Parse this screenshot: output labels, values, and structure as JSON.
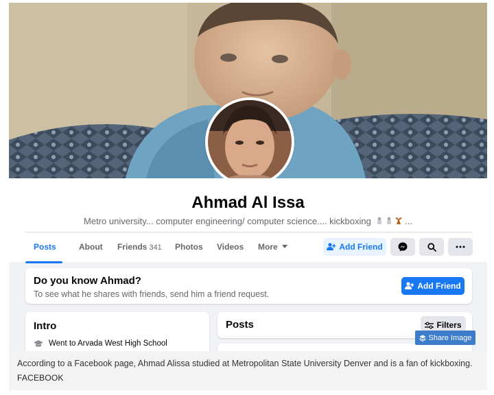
{
  "profile": {
    "name": "Ahmad Al Issa",
    "bio": "Metro university... computer engineering/ computer science.... kickboxing",
    "bio_suffix": "..."
  },
  "tabs": [
    {
      "label": "Posts",
      "active": true
    },
    {
      "label": "About"
    },
    {
      "label": "Friends",
      "count": "341"
    },
    {
      "label": "Photos"
    },
    {
      "label": "Videos"
    },
    {
      "label": "More"
    }
  ],
  "actions": {
    "add_friend": "Add Friend",
    "messenger_icon": "messenger-icon",
    "search_icon": "search-icon",
    "more_icon": "ellipsis-icon"
  },
  "know_card": {
    "title": "Do you know Ahmad?",
    "subtitle": "To see what he shares with friends, send him a friend request.",
    "button": "Add Friend"
  },
  "intro": {
    "title": "Intro",
    "items": [
      {
        "icon": "graduation-cap-icon",
        "text": "Went to Arvada West High School"
      }
    ]
  },
  "posts": {
    "title": "Posts",
    "filters": "Filters"
  },
  "share_image": "Share Image",
  "caption": {
    "text": "According to a Facebook page, Ahmad Alissa studied at Metropolitan State University Denver and is a fan of kickboxing.",
    "credit": "FACEBOOK"
  },
  "colors": {
    "facebook_blue": "#1877f2",
    "light_blue_button": "#e7f3ff",
    "grey_button": "#e4e6eb",
    "page_background": "#f0f2f5",
    "share_button": "#3d7ccb"
  }
}
